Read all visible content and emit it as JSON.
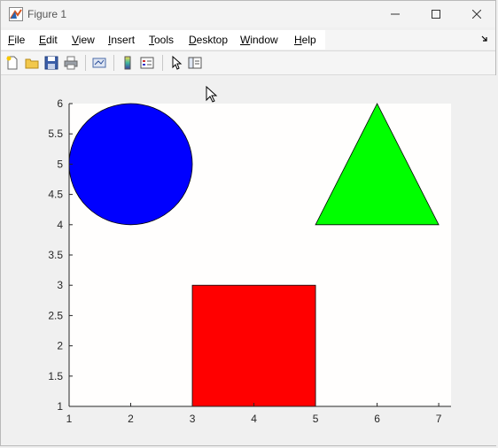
{
  "window": {
    "title": "Figure 1",
    "minimize_icon": "minimize-icon",
    "maximize_icon": "maximize-icon",
    "close_icon": "close-icon"
  },
  "menu": [
    {
      "label": "File",
      "accel": "F",
      "rest": "ile"
    },
    {
      "label": "Edit",
      "accel": "E",
      "rest": "dit"
    },
    {
      "label": "View",
      "accel": "V",
      "rest": "iew"
    },
    {
      "label": "Insert",
      "accel": "I",
      "rest": "nsert"
    },
    {
      "label": "Tools",
      "accel": "T",
      "rest": "ools"
    },
    {
      "label": "Desktop",
      "accel": "D",
      "rest": "esktop"
    },
    {
      "label": "Window",
      "accel": "W",
      "rest": "indow"
    },
    {
      "label": "Help",
      "accel": "H",
      "rest": "elp"
    }
  ],
  "toolbar": [
    "new-figure-icon",
    "open-file-icon",
    "save-icon",
    "print-icon",
    "link-plot-icon",
    "insert-colorbar-icon",
    "insert-legend-icon",
    "edit-plot-icon",
    "property-inspector-icon"
  ],
  "chart_data": {
    "type": "shapes",
    "xlim": [
      1,
      7.2
    ],
    "ylim": [
      1,
      6
    ],
    "xticks": [
      1,
      2,
      3,
      4,
      5,
      6,
      7
    ],
    "yticks": [
      1,
      1.5,
      2,
      2.5,
      3,
      3.5,
      4,
      4.5,
      5,
      5.5,
      6
    ],
    "ytick_labels": [
      "1",
      "1.5",
      "2",
      "2.5",
      "3",
      "3.5",
      "4",
      "4.5",
      "5",
      "5.5",
      "6"
    ],
    "shapes": [
      {
        "kind": "circle",
        "center": [
          2,
          5
        ],
        "radius": 1,
        "color": "#0000ff"
      },
      {
        "kind": "triangle",
        "vertices": [
          [
            5,
            4
          ],
          [
            7,
            4
          ],
          [
            6,
            6
          ]
        ],
        "color": "#00ff00"
      },
      {
        "kind": "rectangle",
        "x": [
          3,
          5
        ],
        "y": [
          1,
          3
        ],
        "color": "#ff0000"
      }
    ]
  }
}
